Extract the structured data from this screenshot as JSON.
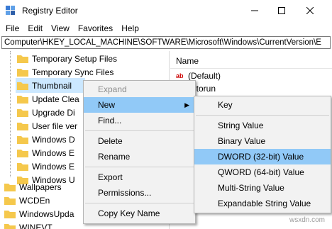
{
  "window": {
    "title": "Registry Editor",
    "controls": {
      "minimize": "—",
      "maximize": "☐",
      "close": "✕"
    }
  },
  "menubar": {
    "items": [
      "File",
      "Edit",
      "View",
      "Favorites",
      "Help"
    ]
  },
  "address": {
    "path": "Computer\\HKEY_LOCAL_MACHINE\\SOFTWARE\\Microsoft\\Windows\\CurrentVersion\\E"
  },
  "tree": {
    "items": [
      "Temporary Setup Files",
      "Temporary Sync Files",
      "Thumbnail",
      "Update Clea",
      "Upgrade Di",
      "User file ver",
      "Windows D",
      "Windows E",
      "Windows E",
      "Windows U",
      "Wallpapers",
      "WCDEn",
      "WindowsUpda",
      "WINEVT"
    ]
  },
  "values_pane": {
    "column_name": "Name",
    "rows": [
      "(Default)",
      "utorun"
    ]
  },
  "context_menu": {
    "items": {
      "expand": "Expand",
      "new": "New",
      "find": "Find...",
      "delete": "Delete",
      "rename": "Rename",
      "export": "Export",
      "permissions": "Permissions...",
      "copy_key_name": "Copy Key Name"
    },
    "submenu_arrow": "▶"
  },
  "submenu": {
    "items": {
      "key": "Key",
      "string_value": "String Value",
      "binary_value": "Binary Value",
      "dword_value": "DWORD (32-bit) Value",
      "qword_value": "QWORD (64-bit) Value",
      "multi_string_value": "Multi-String Value",
      "expandable_string_value": "Expandable String Value"
    }
  },
  "watermark": "wsxdn.com",
  "colors": {
    "selection": "#cce8ff",
    "menu_hover": "#91c9f7",
    "menu_bg": "#f2f2f2",
    "folder": "#f5c84c"
  }
}
